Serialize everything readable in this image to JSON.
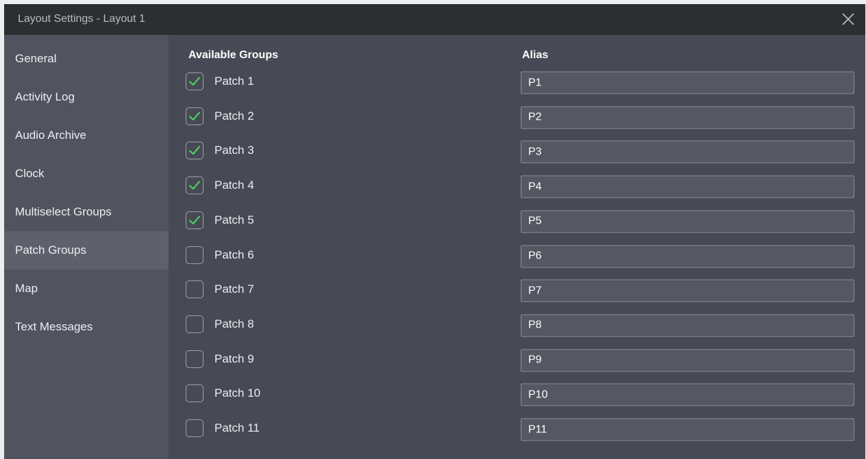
{
  "window": {
    "title": "Layout Settings - Layout 1"
  },
  "sidebar": {
    "items": [
      {
        "label": "General",
        "active": false
      },
      {
        "label": "Activity Log",
        "active": false
      },
      {
        "label": "Audio Archive",
        "active": false
      },
      {
        "label": "Clock",
        "active": false
      },
      {
        "label": "Multiselect Groups",
        "active": false
      },
      {
        "label": "Patch Groups",
        "active": true
      },
      {
        "label": "Map",
        "active": false
      },
      {
        "label": "Text Messages",
        "active": false
      }
    ]
  },
  "main": {
    "groups_header": "Available Groups",
    "alias_header": "Alias",
    "rows": [
      {
        "label": "Patch 1",
        "checked": true,
        "alias": "P1"
      },
      {
        "label": "Patch 2",
        "checked": true,
        "alias": "P2"
      },
      {
        "label": "Patch 3",
        "checked": true,
        "alias": "P3"
      },
      {
        "label": "Patch 4",
        "checked": true,
        "alias": "P4"
      },
      {
        "label": "Patch 5",
        "checked": true,
        "alias": "P5"
      },
      {
        "label": "Patch 6",
        "checked": false,
        "alias": "P6"
      },
      {
        "label": "Patch 7",
        "checked": false,
        "alias": "P7"
      },
      {
        "label": "Patch 8",
        "checked": false,
        "alias": "P8"
      },
      {
        "label": "Patch 9",
        "checked": false,
        "alias": "P9"
      },
      {
        "label": "Patch 10",
        "checked": false,
        "alias": "P10"
      },
      {
        "label": "Patch 11",
        "checked": false,
        "alias": "P11"
      }
    ]
  },
  "colors": {
    "check_mark": "#4cd964"
  }
}
